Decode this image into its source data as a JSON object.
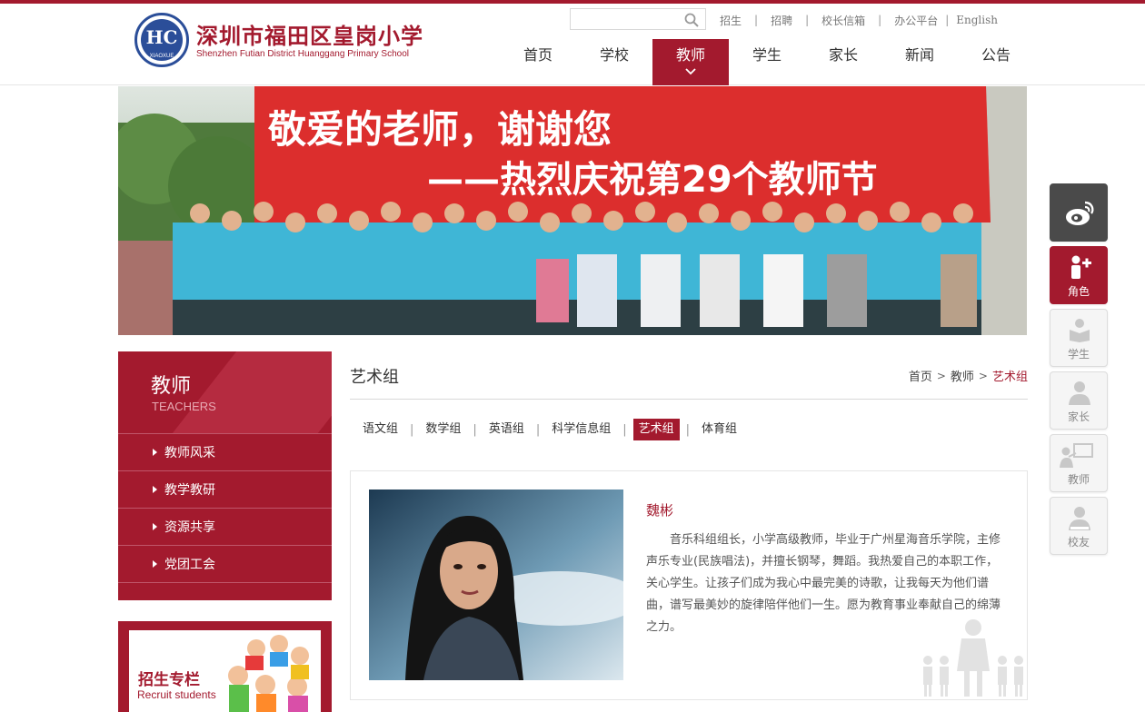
{
  "header": {
    "logo": {
      "emblem_letters": "HC",
      "emblem_text": "XIAOXUE",
      "school_name_cn": "深圳市福田区皇岗小学",
      "school_name_en": "Shenzhen Futian District Huanggang Primary School"
    },
    "search": {
      "placeholder": "",
      "icon": "search-icon"
    },
    "top_links": [
      "招生",
      "招聘",
      "校长信箱",
      "办公平台",
      "English"
    ],
    "nav": [
      {
        "label": "首页",
        "active": false
      },
      {
        "label": "学校",
        "active": false
      },
      {
        "label": "教师",
        "active": true
      },
      {
        "label": "学生",
        "active": false
      },
      {
        "label": "家长",
        "active": false
      },
      {
        "label": "新闻",
        "active": false
      },
      {
        "label": "公告",
        "active": false
      }
    ]
  },
  "banner": {
    "line1": "敬爱的老师，谢谢您",
    "line2": "——热烈庆祝第29个教师节"
  },
  "sidebar": {
    "title_cn": "教师",
    "title_en": "TEACHERS",
    "items": [
      "教师风采",
      "教学教研",
      "资源共享",
      "党团工会"
    ],
    "recruit": {
      "title_cn": "招生专栏",
      "title_en": "Recruit students"
    }
  },
  "main": {
    "title": "艺术组",
    "breadcrumb": [
      "首页",
      "教师",
      "艺术组"
    ],
    "tabs": [
      {
        "label": "语文组",
        "active": false
      },
      {
        "label": "数学组",
        "active": false
      },
      {
        "label": "英语组",
        "active": false
      },
      {
        "label": "科学信息组",
        "active": false
      },
      {
        "label": "艺术组",
        "active": true
      },
      {
        "label": "体育组",
        "active": false
      }
    ],
    "teacher": {
      "name": "魏彬",
      "bio": "音乐科组组长，小学高级教师，毕业于广州星海音乐学院，主修声乐专业(民族唱法)，并擅长钢琴，舞蹈。我热爱自己的本职工作，关心学生。让孩子们成为我心中最完美的诗歌，让我每天为他们谱曲，谱写最美妙的旋律陪伴他们一生。愿为教育事业奉献自己的绵薄之力。"
    }
  },
  "floatbar": [
    {
      "label": "",
      "icon": "weibo-icon"
    },
    {
      "label": "角色",
      "icon": "role-icon"
    },
    {
      "label": "学生",
      "icon": "student-icon"
    },
    {
      "label": "家长",
      "icon": "parent-icon"
    },
    {
      "label": "教师",
      "icon": "teacher-icon"
    },
    {
      "label": "校友",
      "icon": "alumni-icon"
    }
  ],
  "colors": {
    "brand": "#a31a2e",
    "banner_red": "#e0312f",
    "teal_shirt": "#3fb6d6",
    "text": "#333333"
  }
}
